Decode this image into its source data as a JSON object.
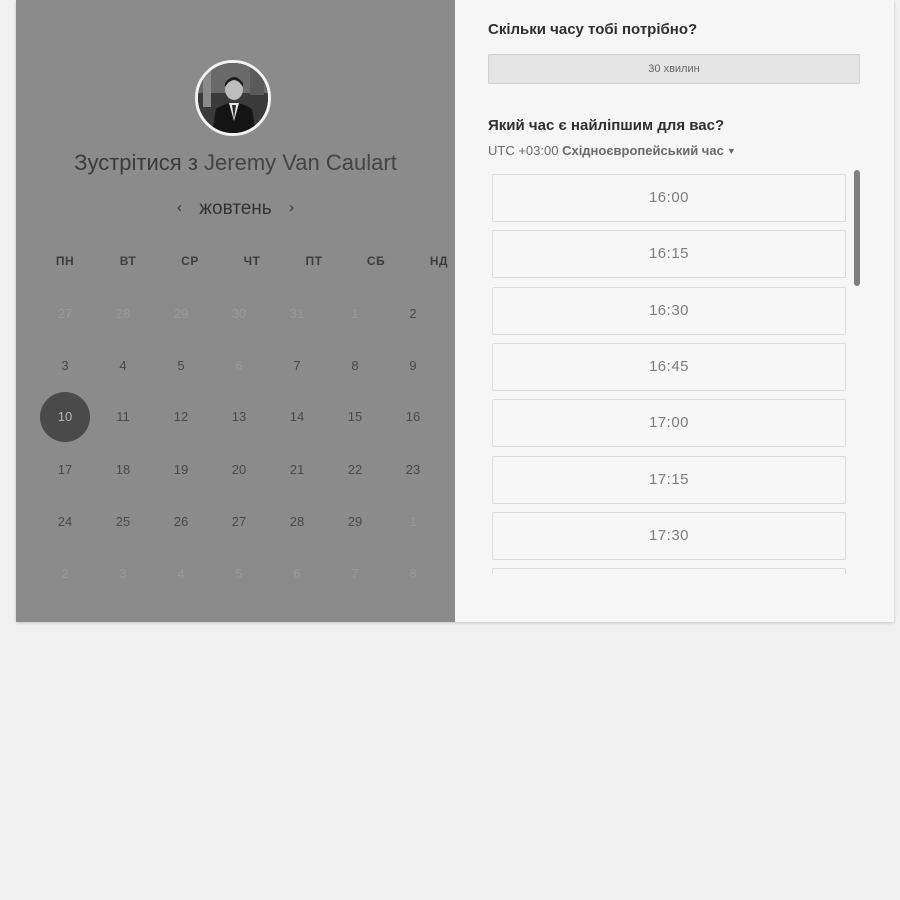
{
  "host": {
    "prefix": "Зустрітися з ",
    "name": "Jeremy Van Caulart"
  },
  "calendar": {
    "month": "жовтень",
    "prev_icon": "chevron-left-icon",
    "next_icon": "chevron-right-icon",
    "weekdays": [
      "ПН",
      "ВТ",
      "СР",
      "ЧТ",
      "ПТ",
      "СБ",
      "НД"
    ],
    "weeks": [
      [
        {
          "d": "27",
          "muted": true
        },
        {
          "d": "28",
          "muted": true
        },
        {
          "d": "29",
          "muted": true
        },
        {
          "d": "30",
          "muted": true
        },
        {
          "d": "31",
          "muted": true
        },
        {
          "d": "1",
          "muted": true
        },
        {
          "d": "2",
          "muted": false
        }
      ],
      [
        {
          "d": "3",
          "muted": false
        },
        {
          "d": "4",
          "muted": false
        },
        {
          "d": "5",
          "muted": false
        },
        {
          "d": "6",
          "muted": true
        },
        {
          "d": "7",
          "muted": false
        },
        {
          "d": "8",
          "muted": false
        },
        {
          "d": "9",
          "muted": false
        }
      ],
      [
        {
          "d": "10",
          "muted": false,
          "selected": true
        },
        {
          "d": "11",
          "muted": false
        },
        {
          "d": "12",
          "muted": false
        },
        {
          "d": "13",
          "muted": false
        },
        {
          "d": "14",
          "muted": false
        },
        {
          "d": "15",
          "muted": false
        },
        {
          "d": "16",
          "muted": false
        }
      ],
      [
        {
          "d": "17",
          "muted": false
        },
        {
          "d": "18",
          "muted": false
        },
        {
          "d": "19",
          "muted": false
        },
        {
          "d": "20",
          "muted": false
        },
        {
          "d": "21",
          "muted": false
        },
        {
          "d": "22",
          "muted": false
        },
        {
          "d": "23",
          "muted": false
        }
      ],
      [
        {
          "d": "24",
          "muted": false
        },
        {
          "d": "25",
          "muted": false
        },
        {
          "d": "26",
          "muted": false
        },
        {
          "d": "27",
          "muted": false
        },
        {
          "d": "28",
          "muted": false
        },
        {
          "d": "29",
          "muted": false
        },
        {
          "d": "1",
          "muted": true
        }
      ],
      [
        {
          "d": "2",
          "muted": true
        },
        {
          "d": "3",
          "muted": true
        },
        {
          "d": "4",
          "muted": true
        },
        {
          "d": "5",
          "muted": true
        },
        {
          "d": "6",
          "muted": true
        },
        {
          "d": "7",
          "muted": true
        },
        {
          "d": "8",
          "muted": true
        }
      ]
    ]
  },
  "booking": {
    "duration_question": "Скільки часу тобі потрібно?",
    "duration_value": "30 хвилин",
    "time_question": "Який час є найліпшим для вас?",
    "tz_offset": "UTC +03:00 ",
    "tz_name": "Східноєвропейський час",
    "tz_caret_icon": "caret-down-icon",
    "slots": [
      "16:00",
      "16:15",
      "16:30",
      "16:45",
      "17:00",
      "17:15",
      "17:30",
      ""
    ]
  },
  "colors": {
    "left_panel": "#8b8b8b",
    "page_bg": "#f0f0f0",
    "selected_day": "#4a4a4a"
  }
}
